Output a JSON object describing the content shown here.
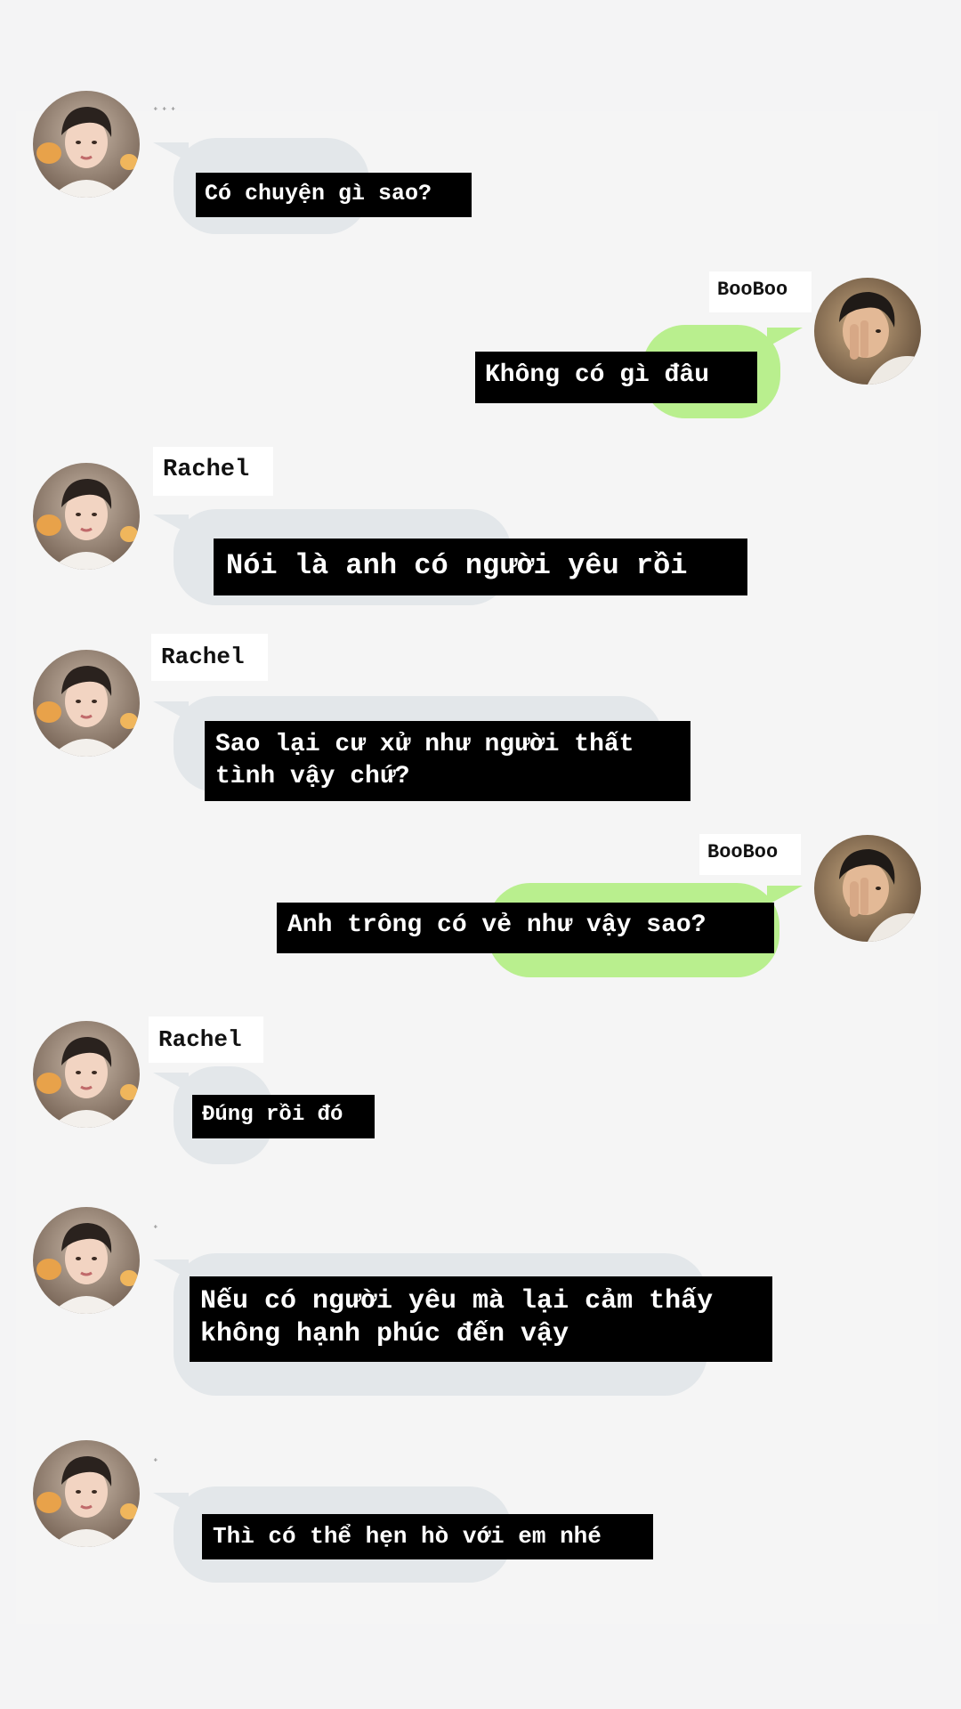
{
  "colors": {
    "background": "#f4f4f5",
    "received_bubble": "#e3e7ea",
    "sent_bubble": "#b9ef8e",
    "caption_bg": "#000000",
    "caption_text": "#ffffff"
  },
  "contacts": {
    "other": {
      "name": "Rachel",
      "avatar_icon": "profile-photo-young-man"
    },
    "self": {
      "name": "BooBoo",
      "avatar_icon": "profile-photo-covering-face"
    }
  },
  "messages": [
    {
      "side": "left",
      "sender": "",
      "text": "Có chuyện gì sao?"
    },
    {
      "side": "right",
      "sender": "BooBoo",
      "text": "Không có gì đâu"
    },
    {
      "side": "left",
      "sender": "Rachel",
      "text": "Nói là anh có người yêu rồi"
    },
    {
      "side": "left",
      "sender": "Rachel",
      "text": "Sao lại cư xử như người thất\ntình vậy chứ?"
    },
    {
      "side": "right",
      "sender": "BooBoo",
      "text": "Anh trông có vẻ như vậy sao?"
    },
    {
      "side": "left",
      "sender": "Rachel",
      "text": "Đúng rồi đó"
    },
    {
      "side": "left",
      "sender": "",
      "text": "Nếu có người yêu mà lại cảm thấy\nkhông hạnh phúc đến vậy"
    },
    {
      "side": "left",
      "sender": "",
      "text": "Thì có thể hẹn hò với em nhé"
    }
  ]
}
